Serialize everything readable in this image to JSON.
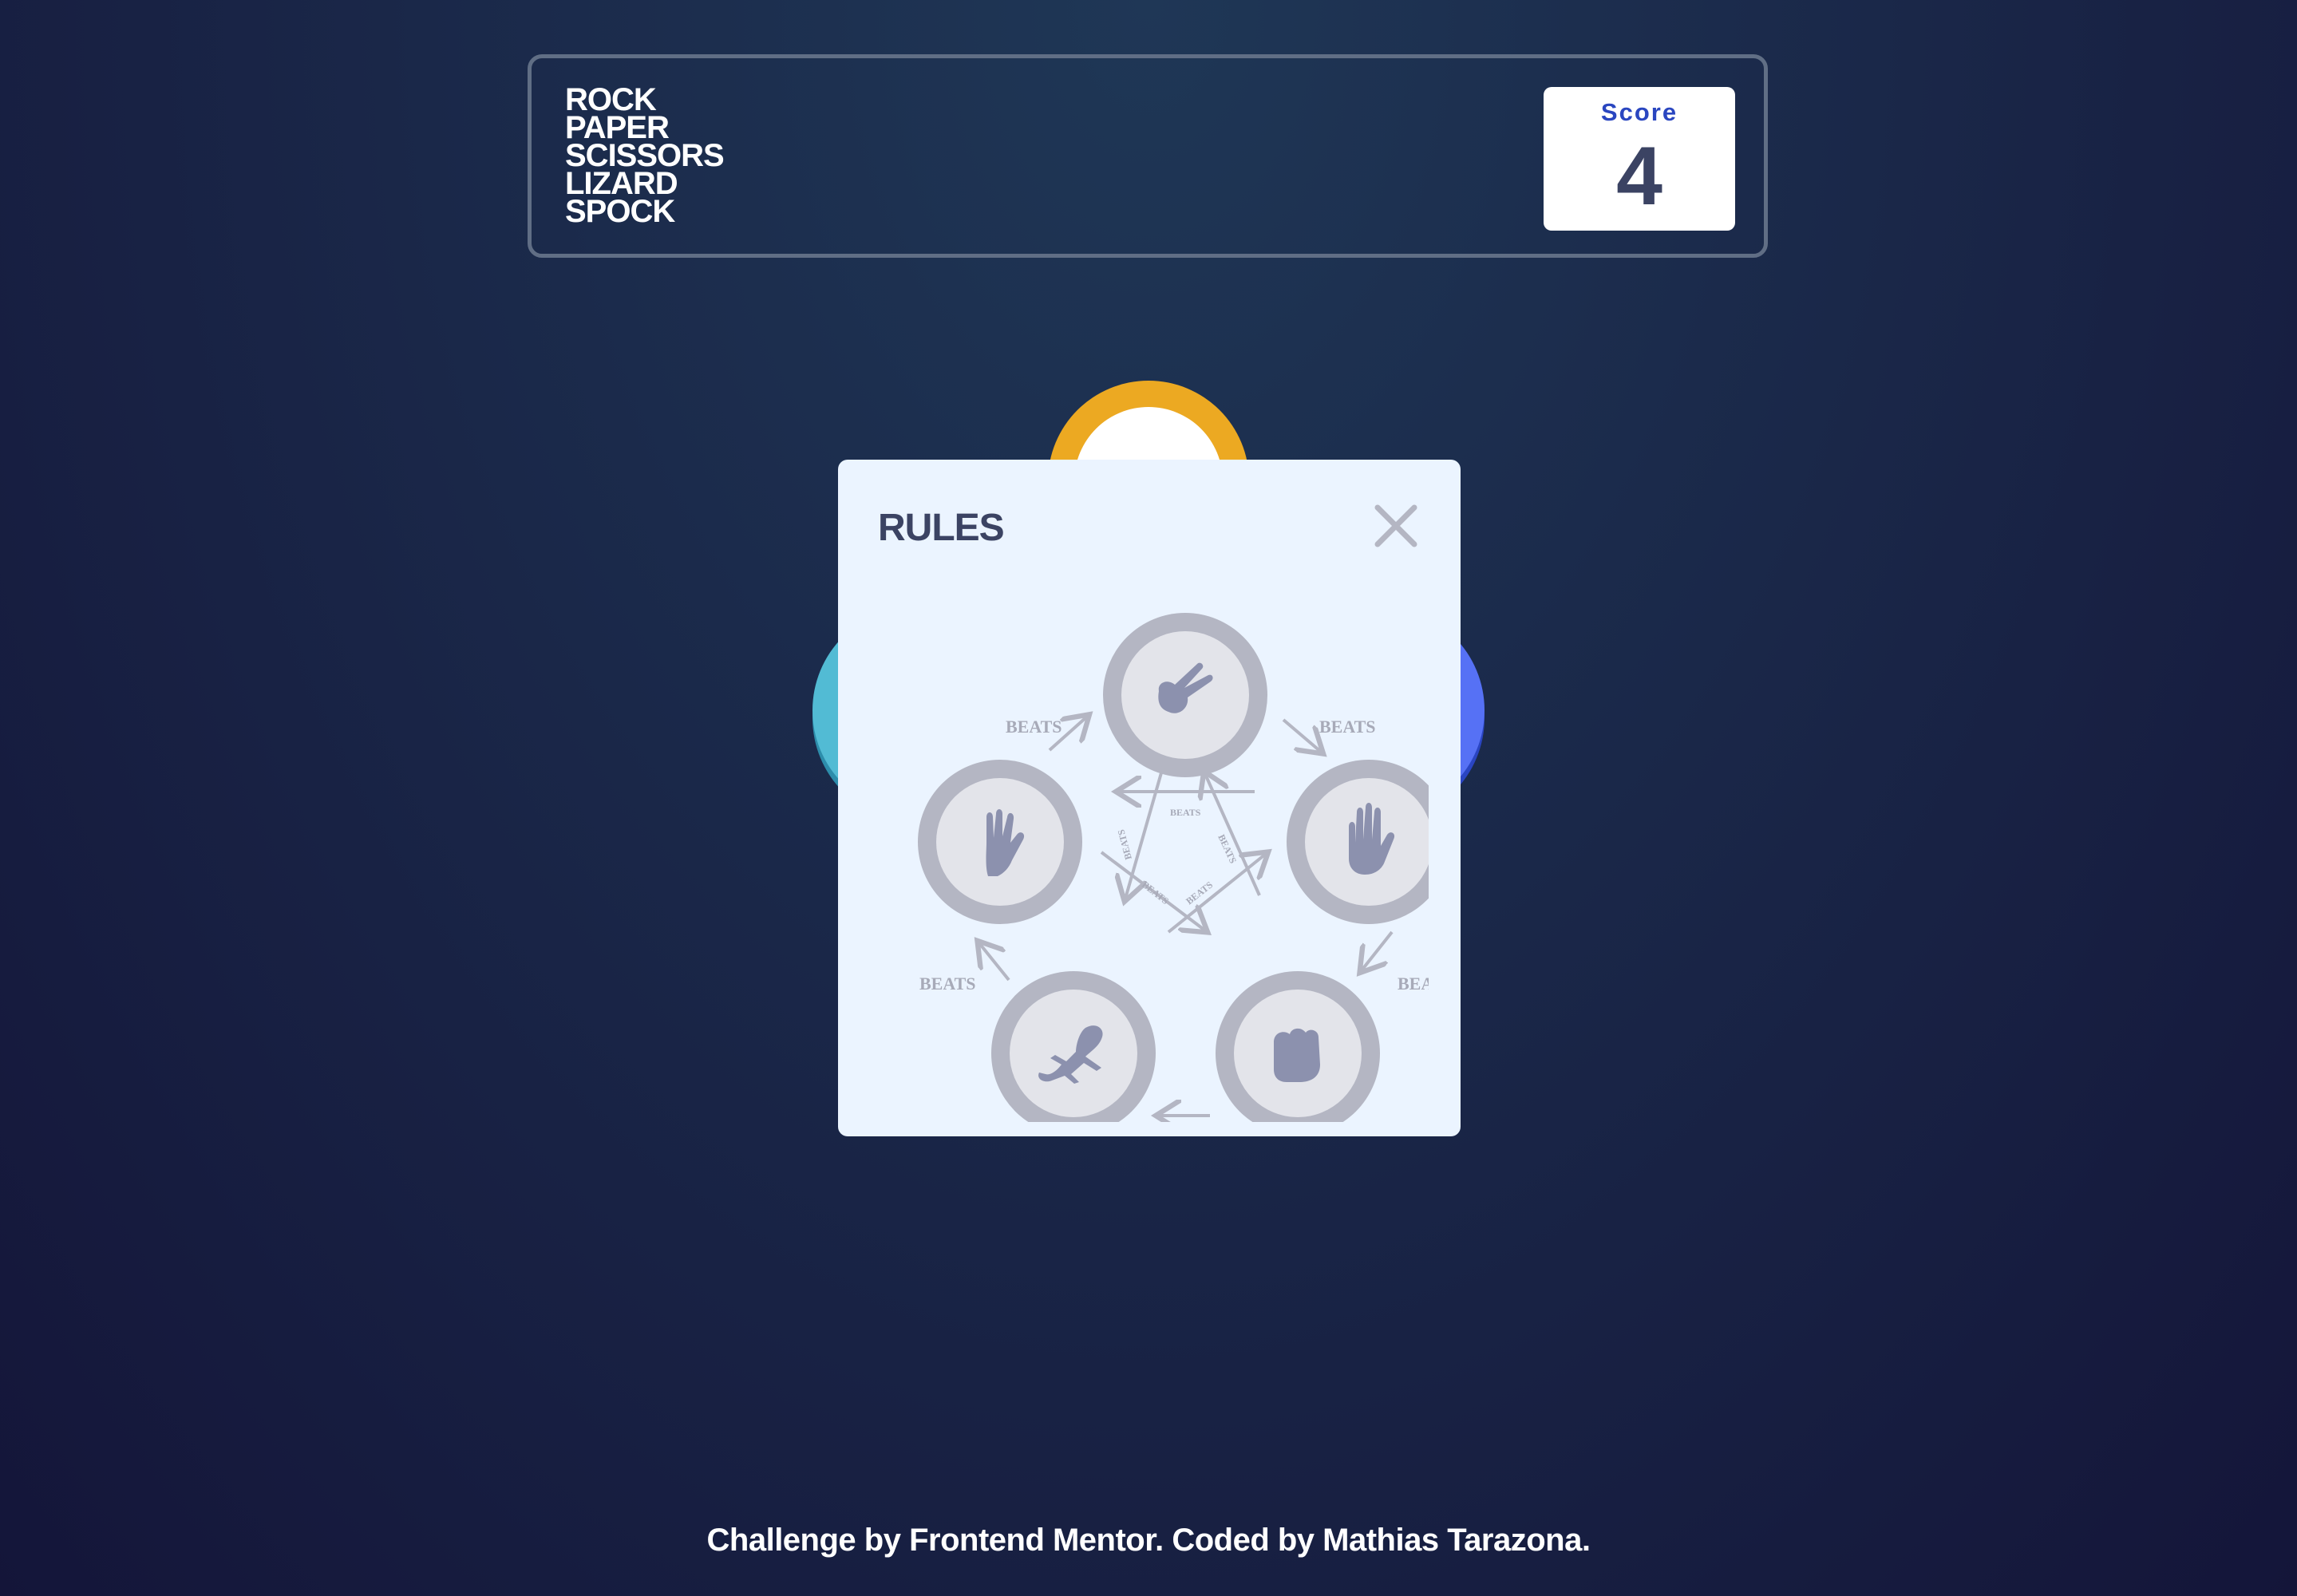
{
  "header": {
    "logo_lines": [
      "ROCK",
      "PAPER",
      "SCISSORS",
      "LIZARD",
      "SPOCK"
    ],
    "score_label": "Score",
    "score_value": "4"
  },
  "modal": {
    "title": "RULES",
    "close_icon": "close-icon",
    "beats_label": "BEATS",
    "nodes": [
      "scissors",
      "paper",
      "rock",
      "lizard",
      "spock"
    ]
  },
  "footer": {
    "text": "Challenge by Frontend Mentor. Coded by Mathias Tarazona."
  },
  "colors": {
    "background_top": "#1f3756",
    "background_bottom": "#141539",
    "score_label": "#2a46c0",
    "dark_text": "#3b4363",
    "header_outline": "#606e85",
    "scissors": "#eca922",
    "lizard_token": "#52bbd4",
    "paper_token": "#5671f5",
    "modal_bg": "#ebf4ff",
    "diagram_gray": "#b4b6c3",
    "diagram_icon": "#8c91ae"
  }
}
